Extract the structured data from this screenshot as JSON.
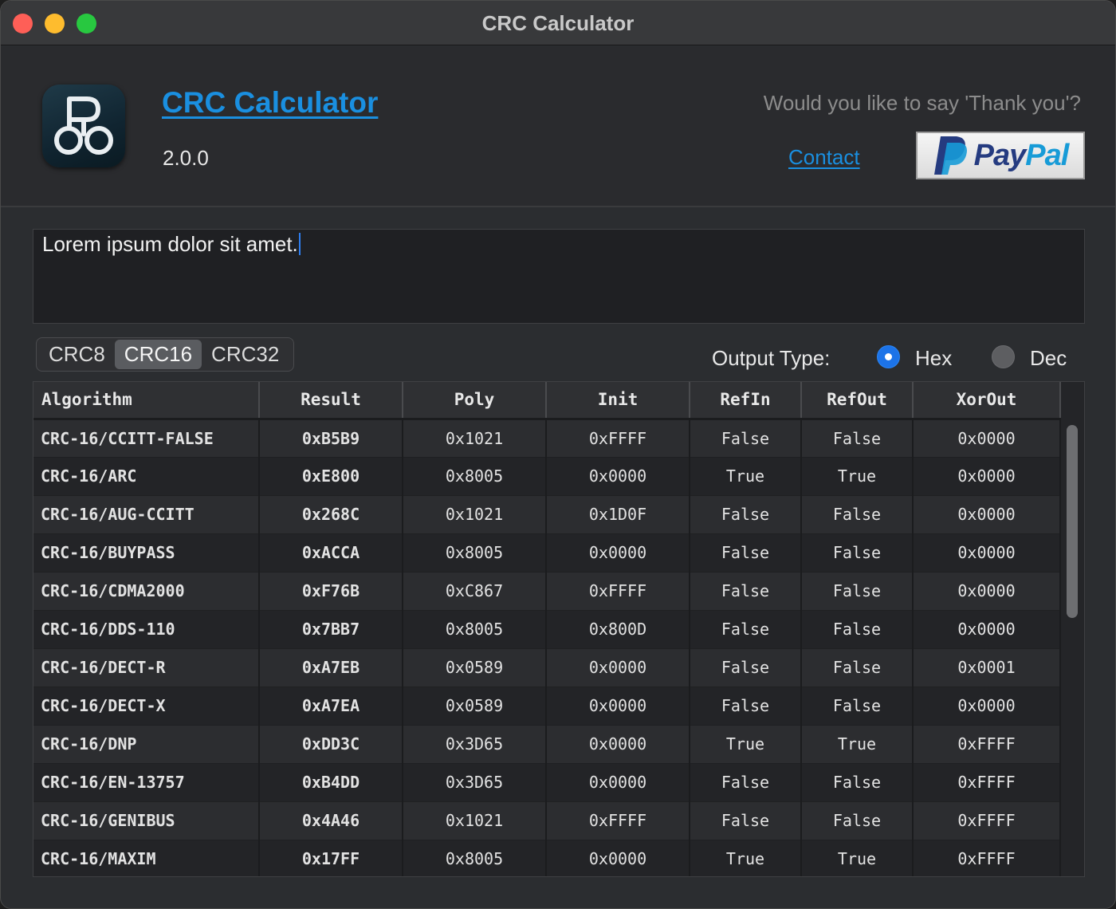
{
  "window": {
    "title": "CRC Calculator"
  },
  "header": {
    "app_name": "CRC Calculator",
    "version": "2.0.0",
    "thanks_text": "Would you like to say 'Thank you'?",
    "contact_label": "Contact",
    "paypal_label": {
      "a": "Pay",
      "b": "Pal"
    },
    "icon": "app-logo-icon"
  },
  "input": {
    "text": "Lorem ipsum dolor sit amet."
  },
  "tabs": [
    {
      "label": "CRC8",
      "active": false
    },
    {
      "label": "CRC16",
      "active": true
    },
    {
      "label": "CRC32",
      "active": false
    }
  ],
  "output_type": {
    "label": "Output Type:",
    "options": [
      {
        "label": "Hex",
        "selected": true
      },
      {
        "label": "Dec",
        "selected": false
      }
    ]
  },
  "table": {
    "columns": [
      "Algorithm",
      "Result",
      "Poly",
      "Init",
      "RefIn",
      "RefOut",
      "XorOut"
    ],
    "rows": [
      [
        "CRC-16/CCITT-FALSE",
        "0xB5B9",
        "0x1021",
        "0xFFFF",
        "False",
        "False",
        "0x0000"
      ],
      [
        "CRC-16/ARC",
        "0xE800",
        "0x8005",
        "0x0000",
        "True",
        "True",
        "0x0000"
      ],
      [
        "CRC-16/AUG-CCITT",
        "0x268C",
        "0x1021",
        "0x1D0F",
        "False",
        "False",
        "0x0000"
      ],
      [
        "CRC-16/BUYPASS",
        "0xACCA",
        "0x8005",
        "0x0000",
        "False",
        "False",
        "0x0000"
      ],
      [
        "CRC-16/CDMA2000",
        "0xF76B",
        "0xC867",
        "0xFFFF",
        "False",
        "False",
        "0x0000"
      ],
      [
        "CRC-16/DDS-110",
        "0x7BB7",
        "0x8005",
        "0x800D",
        "False",
        "False",
        "0x0000"
      ],
      [
        "CRC-16/DECT-R",
        "0xA7EB",
        "0x0589",
        "0x0000",
        "False",
        "False",
        "0x0001"
      ],
      [
        "CRC-16/DECT-X",
        "0xA7EA",
        "0x0589",
        "0x0000",
        "False",
        "False",
        "0x0000"
      ],
      [
        "CRC-16/DNP",
        "0xDD3C",
        "0x3D65",
        "0x0000",
        "True",
        "True",
        "0xFFFF"
      ],
      [
        "CRC-16/EN-13757",
        "0xB4DD",
        "0x3D65",
        "0x0000",
        "False",
        "False",
        "0xFFFF"
      ],
      [
        "CRC-16/GENIBUS",
        "0x4A46",
        "0x1021",
        "0xFFFF",
        "False",
        "False",
        "0xFFFF"
      ],
      [
        "CRC-16/MAXIM",
        "0x17FF",
        "0x8005",
        "0x0000",
        "True",
        "True",
        "0xFFFF"
      ]
    ]
  },
  "colors": {
    "accent": "#1a8fe0",
    "radio_selected": "#1c73e8",
    "close": "#fe5f57",
    "minimize": "#febc2e",
    "maximize": "#28c840"
  }
}
